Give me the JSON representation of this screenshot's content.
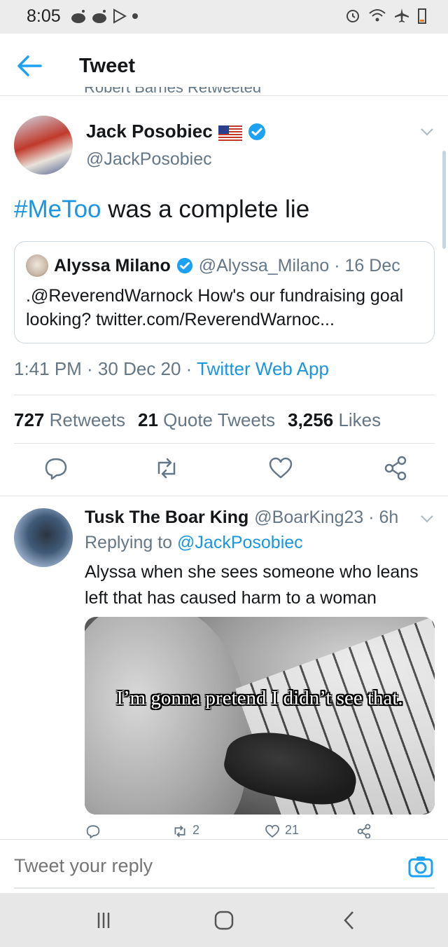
{
  "status_bar": {
    "time": "8:05"
  },
  "app_bar": {
    "title": "Tweet",
    "retweet_peek": "Robert Barnes Retweeted"
  },
  "tweet": {
    "author": {
      "name": "Jack Posobiec",
      "handle": "@JackPosobiec",
      "flag_emoji": "🇺🇸"
    },
    "text_hashtag": "#MeToo",
    "text_rest": " was a complete lie",
    "quoted": {
      "name": "Alyssa Milano",
      "handle_date": "@Alyssa_Milano · 16 Dec",
      "body": ".@ReverendWarnock How's our fundraising goal looking? twitter.com/ReverendWarnoc..."
    },
    "meta": {
      "time_date": "1:41 PM · 30 Dec 20 · ",
      "source": "Twitter Web App"
    },
    "stats": {
      "retweets_count": "727",
      "retweets_label": "Retweets",
      "quotes_count": "21",
      "quotes_label": "Quote Tweets",
      "likes_count": "3,256",
      "likes_label": "Likes"
    }
  },
  "reply": {
    "name": "Tusk The Boar King",
    "handle_time": "@BoarKing23 · 6h",
    "replying_prefix": "Replying to ",
    "replying_to": "@JackPosobiec",
    "text": "Alyssa when she sees someone who leans left that has caused harm to a woman",
    "media_caption": "I’m gonna pretend I didn’t see that.",
    "retweet_count": "2",
    "like_count": "21"
  },
  "composer": {
    "placeholder": "Tweet your reply"
  },
  "colors": {
    "link": "#1b95e0",
    "secondary_text": "#657786",
    "verified": "#1da1f2"
  }
}
